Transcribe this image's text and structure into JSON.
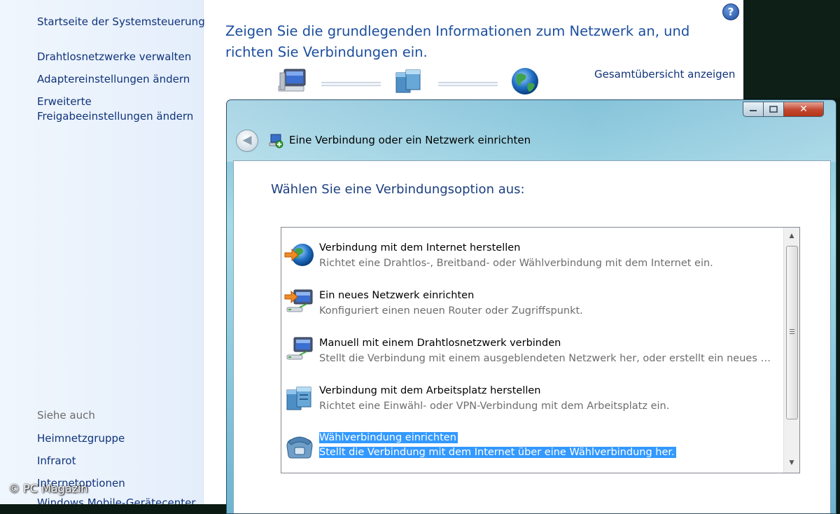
{
  "control_panel": {
    "sidebar": {
      "home_link": "Startseite der Systemsteuerung",
      "links": [
        "Drahtlosnetzwerke verwalten",
        "Adaptereinstellungen ändern",
        "Erweiterte",
        "Freigabeeinstellungen ändern"
      ],
      "see_also_label": "Siehe auch",
      "see_also_links": [
        "Heimnetzgruppe",
        "Infrarot",
        "Internetoptionen",
        "Windows Mobile-Gerätecenter"
      ]
    },
    "title_line1": "Zeigen Sie die grundlegenden Informationen zum Netzwerk an, und",
    "title_line2": "richten Sie Verbindungen ein.",
    "overview_link": "Gesamtübersicht anzeigen",
    "help_glyph": "?",
    "icons": [
      "computer-icon",
      "network-icon",
      "globe-icon",
      "help-icon"
    ]
  },
  "dialog": {
    "title": "Eine Verbindung oder ein Netzwerk einrichten",
    "heading": "Wählen Sie eine Verbindungsoption aus:",
    "close_glyph": "✕",
    "back_glyph": "◀",
    "options": [
      {
        "title": "Verbindung mit dem Internet herstellen",
        "description": "Richtet eine Drahtlos-, Breitband- oder Wählverbindung mit dem Internet ein.",
        "icon": "globe-arrow-icon",
        "selected": false
      },
      {
        "title": "Ein neues Netzwerk einrichten",
        "description": "Konfiguriert einen neuen Router oder Zugriffspunkt.",
        "icon": "new-network-icon",
        "selected": false
      },
      {
        "title": "Manuell mit einem Drahtlosnetzwerk verbinden",
        "description": "Stellt die Verbindung mit einem ausgeblendeten Netzwerk her, oder erstellt ein neues Drahtlosprofil.",
        "icon": "wireless-network-icon",
        "selected": false
      },
      {
        "title": "Verbindung mit dem Arbeitsplatz herstellen",
        "description": "Richtet eine Einwähl- oder VPN-Verbindung mit dem Arbeitsplatz ein.",
        "icon": "workplace-icon",
        "selected": false
      },
      {
        "title": "Wählverbindung einrichten",
        "description": "Stellt die Verbindung mit dem Internet über eine Wählverbindung her.",
        "icon": "telephone-icon",
        "selected": true
      }
    ],
    "scroll_up_glyph": "▲",
    "scroll_down_glyph": "▼"
  },
  "watermark": "© PC Magazin",
  "colors": {
    "link": "#10337a",
    "heading": "#1a4e9e",
    "selection": "#3399ff",
    "dialog_frame": "#8fcbe0"
  }
}
